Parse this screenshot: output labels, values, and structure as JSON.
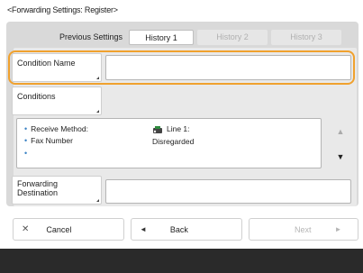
{
  "screen": {
    "title": "<Forwarding Settings: Register>"
  },
  "tabs": [
    {
      "label": "Previous Settings",
      "state": "normal"
    },
    {
      "label": "History 1",
      "state": "active"
    },
    {
      "label": "History 2",
      "state": "disabled"
    },
    {
      "label": "History 3",
      "state": "disabled"
    }
  ],
  "condition_name": {
    "label": "Condition Name",
    "value": ""
  },
  "conditions": {
    "label": "Conditions",
    "rows": [
      {
        "key": "Receive Method:",
        "value": "Line 1:"
      },
      {
        "key": "Fax Number",
        "value": "Disregarded"
      },
      {
        "key": "",
        "value": ""
      }
    ]
  },
  "forwarding_destination": {
    "label_line1": "Forwarding",
    "label_line2": "Destination",
    "value": ""
  },
  "buttons": {
    "cancel": "Cancel",
    "back": "Back",
    "next": "Next"
  },
  "icons": {
    "cancel": "close-icon",
    "back": "arrow-left-icon",
    "next": "arrow-right-icon",
    "scroll_up": "triangle-up-icon",
    "scroll_down": "triangle-down-icon",
    "line": "fax-line-icon"
  },
  "colors": {
    "focus": "#f0a12e",
    "bullet": "#3b82c4",
    "footer": "#2a2a2a"
  }
}
